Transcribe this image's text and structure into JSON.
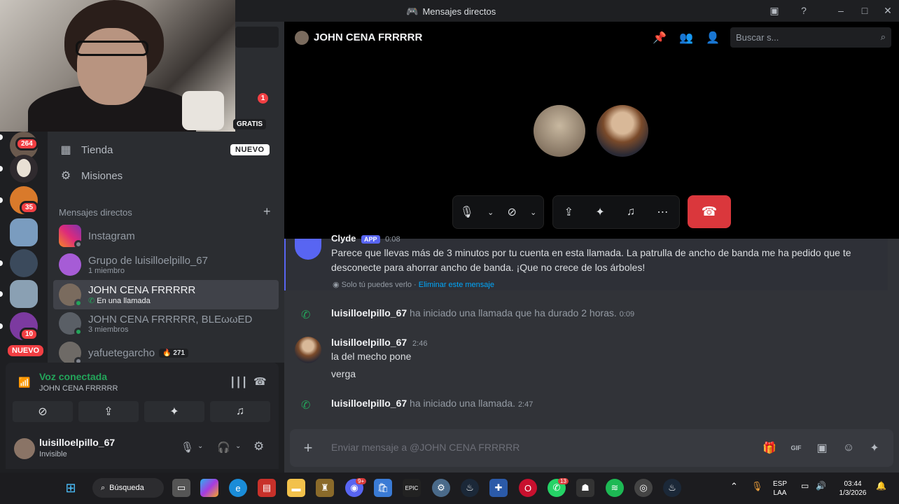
{
  "window": {
    "title": "Mensajes directos"
  },
  "webcam": {
    "badge": "GRATIS",
    "notif_count": "1"
  },
  "servers": [
    {
      "badge": "264"
    },
    {
      "badge": ""
    },
    {
      "badge": "35"
    },
    {
      "badge": ""
    },
    {
      "badge": ""
    },
    {
      "badge": ""
    },
    {
      "badge": "10"
    }
  ],
  "rail_new_label": "NUEVO",
  "nav": {
    "store_label": "Tienda",
    "store_badge": "NUEVO",
    "quests_label": "Misiones"
  },
  "dm_section": {
    "header": "Mensajes directos"
  },
  "dms": [
    {
      "name": "Instagram",
      "sub": ""
    },
    {
      "name": "Grupo de luisilloelpillo_67",
      "sub": "1 miembro"
    },
    {
      "name": "JOHN CENA FRRRRR",
      "sub": "En una llamada"
    },
    {
      "name": "JOHN CENA FRRRRR, BLEωωED",
      "sub": "3 miembros"
    },
    {
      "name": "yafuetegarcho",
      "sub": "",
      "tag": "271"
    }
  ],
  "voice": {
    "status": "Voz conectada",
    "channel": "JOHN CENA FRRRRR"
  },
  "user": {
    "name": "luisilloelpillo_67",
    "status": "Invisible"
  },
  "call": {
    "title": "JOHN CENA FRRRRR",
    "search_placeholder": "Buscar s..."
  },
  "messages": {
    "clyde_name": "Clyde",
    "clyde_tag": "APP",
    "clyde_time": "0:08",
    "clyde_text": "Parece que llevas más de 3 minutos por tu cuenta en esta llamada. La patrulla de ancho de banda me ha pedido que te desconecte para ahorrar ancho de banda. ¡Que no crece de los árboles!",
    "clyde_only_you": "Solo tú puedes verlo · ",
    "clyde_delete": "Eliminar este mensaje",
    "call1_user": "luisilloelpillo_67",
    "call1_text": "ha iniciado una llamada que ha durado 2 horas.",
    "call1_time": "0:09",
    "msg_user": "luisilloelpillo_67",
    "msg_time": "2:46",
    "msg_line1": "la del mecho pone",
    "msg_line2": "verga",
    "call2_user": "luisilloelpillo_67",
    "call2_text": "ha iniciado una llamada.",
    "call2_time": "2:47"
  },
  "composer": {
    "placeholder": "Enviar mensaje a @JOHN CENA FRRRRR"
  },
  "taskbar": {
    "search_label": "Búsqueda",
    "discord_badge": "9+",
    "whatsapp_badge": "13",
    "lang_top": "ESP",
    "lang_bottom": "LAA",
    "time": "03:44",
    "date": "1/3/2026"
  },
  "colors": {
    "accent": "#5865f2",
    "green": "#23a55a",
    "danger": "#da373c"
  }
}
